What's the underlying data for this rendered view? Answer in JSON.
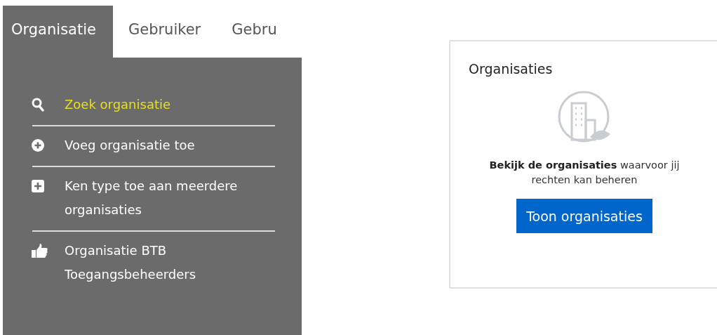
{
  "tabs": [
    {
      "label": "Organisatie",
      "selected": true
    },
    {
      "label": "Gebruiker",
      "selected": false
    },
    {
      "label": "Gebru",
      "selected": false
    }
  ],
  "menu": {
    "items": [
      {
        "label": "Zoek organisatie",
        "kind": "search",
        "selected": true
      },
      {
        "label": "Voeg organisatie toe",
        "kind": "add-circle",
        "selected": false
      },
      {
        "label": "Ken type toe aan meerdere organisaties",
        "kind": "add-square",
        "selected": false
      },
      {
        "label": "Organisatie BTB Toegangsbeheerders",
        "kind": "thumbs-up",
        "selected": false
      }
    ]
  },
  "card": {
    "title": "Organisaties",
    "description": "**Bekijk de organisaties** waarvoor jij rechten kan beheren",
    "button": "Toon organisaties"
  }
}
